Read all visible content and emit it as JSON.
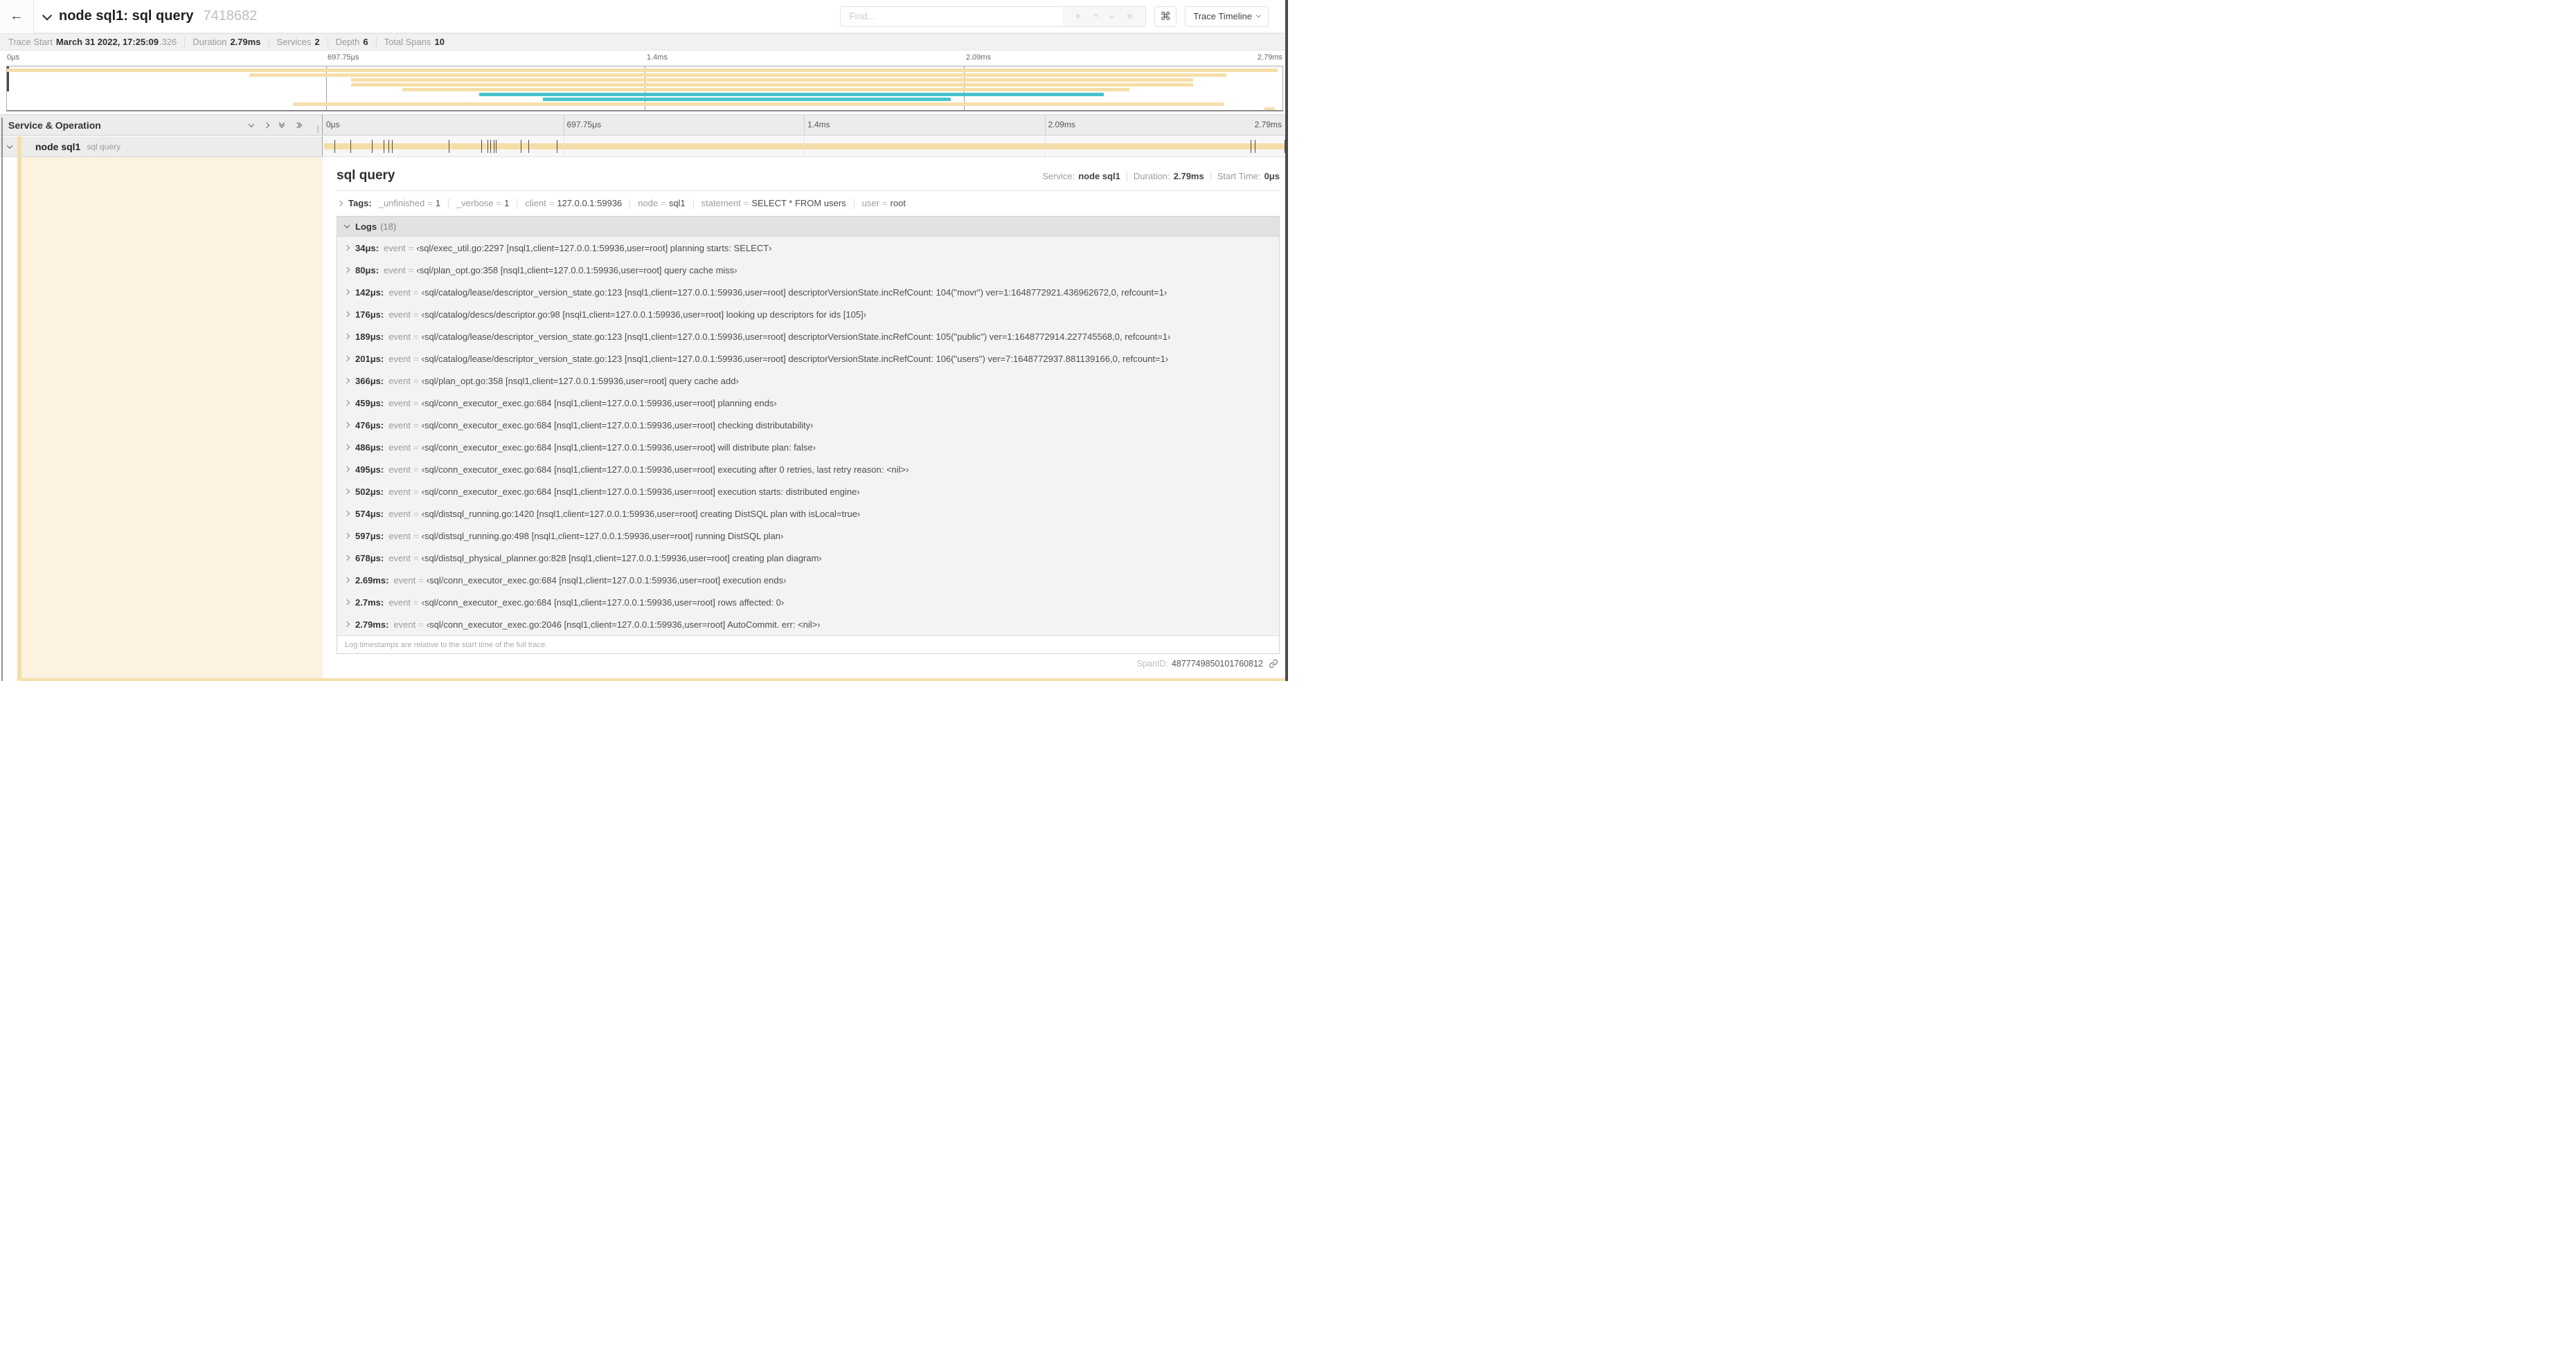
{
  "colors": {
    "tan": "#F5DFA9",
    "teal": "#46C4C9",
    "cream": "#FBF2DF"
  },
  "header": {
    "back_icon": "←",
    "title": "node sql1: sql query",
    "trace_id": "7418682",
    "find_placeholder": "Find...",
    "keyboard_shortcut": "⌘",
    "view_selector": "Trace Timeline"
  },
  "meta": {
    "items": [
      {
        "label": "Trace Start",
        "value": "March 31 2022, 17:25:09",
        "suffix": ".326"
      },
      {
        "label": "Duration",
        "value": "2.79ms"
      },
      {
        "label": "Services",
        "value": "2"
      },
      {
        "label": "Depth",
        "value": "6"
      },
      {
        "label": "Total Spans",
        "value": "10"
      }
    ]
  },
  "minimap": {
    "ticks": [
      {
        "label": "0μs",
        "pct": 0
      },
      {
        "label": "697.75μs",
        "pct": 25
      },
      {
        "label": "1.4ms",
        "pct": 50
      },
      {
        "label": "2.09ms",
        "pct": 75
      },
      {
        "label": "2.79ms",
        "pct": 100
      }
    ],
    "spans": [
      {
        "start": 0,
        "end": 99.6,
        "color": "tan"
      },
      {
        "start": 19,
        "end": 95.6,
        "color": "tan"
      },
      {
        "start": 27,
        "end": 93,
        "color": "tan"
      },
      {
        "start": 27,
        "end": 93,
        "color": "tan"
      },
      {
        "start": 31,
        "end": 88,
        "color": "tan"
      },
      {
        "start": 37,
        "end": 86,
        "color": "teal"
      },
      {
        "start": 42,
        "end": 74,
        "color": "teal"
      },
      {
        "start": 22.4,
        "end": 95.4,
        "color": "tan"
      },
      {
        "start": 98.6,
        "end": 99.4,
        "color": "tan"
      }
    ]
  },
  "timeline": {
    "column_header": "Service & Operation",
    "ruler_ticks": [
      {
        "label": "0μs",
        "pct": 0
      },
      {
        "label": "697.75μs",
        "pct": 25
      },
      {
        "label": "1.4ms",
        "pct": 50
      },
      {
        "label": "2.09ms",
        "pct": 75
      },
      {
        "label": "2.79ms",
        "pct": 100
      }
    ],
    "row": {
      "service": "node sql1",
      "operation": "sql query",
      "bar_color": "tan",
      "tick_positions_pct": [
        1.2,
        2.9,
        5.1,
        6.3,
        6.8,
        7.2,
        13.1,
        16.5,
        17.1,
        17.4,
        17.8,
        18.0,
        20.6,
        21.4,
        24.3,
        96.4,
        96.8,
        99.9
      ]
    }
  },
  "detail": {
    "title": "sql query",
    "service_label": "Service:",
    "service": "node sql1",
    "duration_label": "Duration:",
    "duration": "2.79ms",
    "start_label": "Start Time:",
    "start_time": "0μs",
    "tags_label": "Tags:",
    "tags": [
      {
        "key": "_unfinished",
        "value": "1"
      },
      {
        "key": "_verbose",
        "value": "1"
      },
      {
        "key": "client",
        "value": "127.0.0.1:59936"
      },
      {
        "key": "node",
        "value": "sql1"
      },
      {
        "key": "statement",
        "value": "SELECT * FROM users"
      },
      {
        "key": "user",
        "value": "root"
      }
    ],
    "logs_label": "Logs",
    "logs_count": "(18)",
    "logs": [
      {
        "time": "34μs:",
        "key": "event",
        "value": "‹sql/exec_util.go:2297 [nsql1,client=127.0.0.1:59936,user=root] planning starts: SELECT›"
      },
      {
        "time": "80μs:",
        "key": "event",
        "value": "‹sql/plan_opt.go:358 [nsql1,client=127.0.0.1:59936,user=root] query cache miss›"
      },
      {
        "time": "142μs:",
        "key": "event",
        "value": "‹sql/catalog/lease/descriptor_version_state.go:123 [nsql1,client=127.0.0.1:59936,user=root] descriptorVersionState.incRefCount: 104(\"movr\") ver=1:1648772921.436962672,0, refcount=1›"
      },
      {
        "time": "176μs:",
        "key": "event",
        "value": "‹sql/catalog/descs/descriptor.go:98 [nsql1,client=127.0.0.1:59936,user=root] looking up descriptors for ids [105]›"
      },
      {
        "time": "189μs:",
        "key": "event",
        "value": "‹sql/catalog/lease/descriptor_version_state.go:123 [nsql1,client=127.0.0.1:59936,user=root] descriptorVersionState.incRefCount: 105(\"public\") ver=1:1648772914.227745568,0, refcount=1›"
      },
      {
        "time": "201μs:",
        "key": "event",
        "value": "‹sql/catalog/lease/descriptor_version_state.go:123 [nsql1,client=127.0.0.1:59936,user=root] descriptorVersionState.incRefCount: 106(\"users\") ver=7:1648772937.881139166,0, refcount=1›"
      },
      {
        "time": "366μs:",
        "key": "event",
        "value": "‹sql/plan_opt.go:358 [nsql1,client=127.0.0.1:59936,user=root] query cache add›"
      },
      {
        "time": "459μs:",
        "key": "event",
        "value": "‹sql/conn_executor_exec.go:684 [nsql1,client=127.0.0.1:59936,user=root] planning ends›"
      },
      {
        "time": "476μs:",
        "key": "event",
        "value": "‹sql/conn_executor_exec.go:684 [nsql1,client=127.0.0.1:59936,user=root] checking distributability›"
      },
      {
        "time": "486μs:",
        "key": "event",
        "value": "‹sql/conn_executor_exec.go:684 [nsql1,client=127.0.0.1:59936,user=root] will distribute plan: false›"
      },
      {
        "time": "495μs:",
        "key": "event",
        "value": "‹sql/conn_executor_exec.go:684 [nsql1,client=127.0.0.1:59936,user=root] executing after 0 retries, last retry reason: <nil>›"
      },
      {
        "time": "502μs:",
        "key": "event",
        "value": "‹sql/conn_executor_exec.go:684 [nsql1,client=127.0.0.1:59936,user=root] execution starts: distributed engine›"
      },
      {
        "time": "574μs:",
        "key": "event",
        "value": "‹sql/distsql_running.go:1420 [nsql1,client=127.0.0.1:59936,user=root] creating DistSQL plan with isLocal=true›"
      },
      {
        "time": "597μs:",
        "key": "event",
        "value": "‹sql/distsql_running.go:498 [nsql1,client=127.0.0.1:59936,user=root] running DistSQL plan›"
      },
      {
        "time": "678μs:",
        "key": "event",
        "value": "‹sql/distsql_physical_planner.go:828 [nsql1,client=127.0.0.1:59936,user=root] creating plan diagram›"
      },
      {
        "time": "2.69ms:",
        "key": "event",
        "value": "‹sql/conn_executor_exec.go:684 [nsql1,client=127.0.0.1:59936,user=root] execution ends›"
      },
      {
        "time": "2.7ms:",
        "key": "event",
        "value": "‹sql/conn_executor_exec.go:684 [nsql1,client=127.0.0.1:59936,user=root] rows affected: 0›"
      },
      {
        "time": "2.79ms:",
        "key": "event",
        "value": "‹sql/conn_executor_exec.go:2046 [nsql1,client=127.0.0.1:59936,user=root] AutoCommit. err: <nil>›"
      }
    ],
    "note": "Log timestamps are relative to the start time of the full trace.",
    "span_id_label": "SpanID:",
    "span_id": "4877749850101760812"
  }
}
